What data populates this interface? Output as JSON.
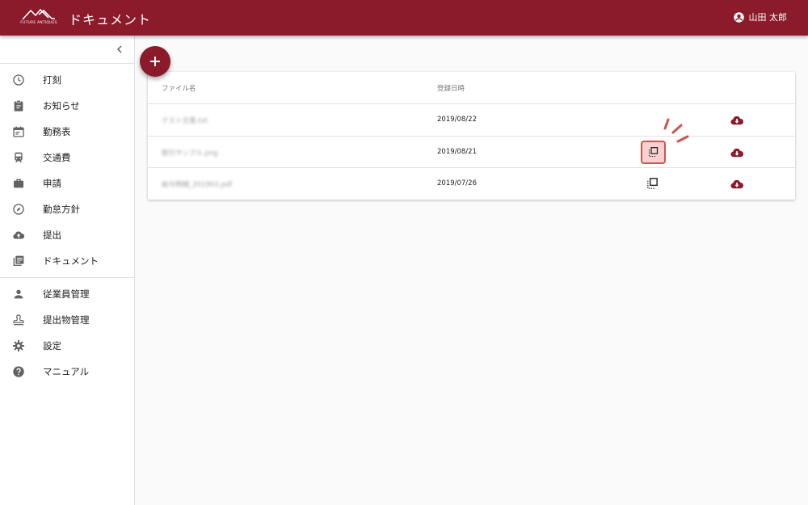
{
  "header": {
    "brand_text": "FUTURE ANTIQUES",
    "title": "ドキュメント",
    "user_name": "山田 太郎"
  },
  "sidebar": {
    "items": [
      {
        "label": "打刻",
        "icon": "clock-icon"
      },
      {
        "label": "お知らせ",
        "icon": "clipboard-icon"
      },
      {
        "label": "勤務表",
        "icon": "calendar-icon"
      },
      {
        "label": "交通費",
        "icon": "train-icon"
      },
      {
        "label": "申請",
        "icon": "briefcase-icon"
      },
      {
        "label": "勤怠方針",
        "icon": "compass-icon"
      },
      {
        "label": "提出",
        "icon": "cloud-upload-icon"
      },
      {
        "label": "ドキュメント",
        "icon": "library-books-icon"
      }
    ],
    "admin_items": [
      {
        "label": "従業員管理",
        "icon": "person-icon"
      },
      {
        "label": "提出物管理",
        "icon": "stamp-icon"
      },
      {
        "label": "設定",
        "icon": "gear-icon"
      },
      {
        "label": "マニュアル",
        "icon": "help-icon"
      }
    ]
  },
  "table": {
    "columns": {
      "name": "ファイル名",
      "date": "登録日時"
    },
    "rows": [
      {
        "name": "テスト文書.txt",
        "date": "2019/08/22"
      },
      {
        "name": "取引サンプル.png",
        "date": "2019/08/21"
      },
      {
        "name": "給与明細_201903.pdf",
        "date": "2019/07/26"
      }
    ]
  },
  "colors": {
    "brand": "#8b1a2b",
    "highlight": "#c9574f"
  }
}
